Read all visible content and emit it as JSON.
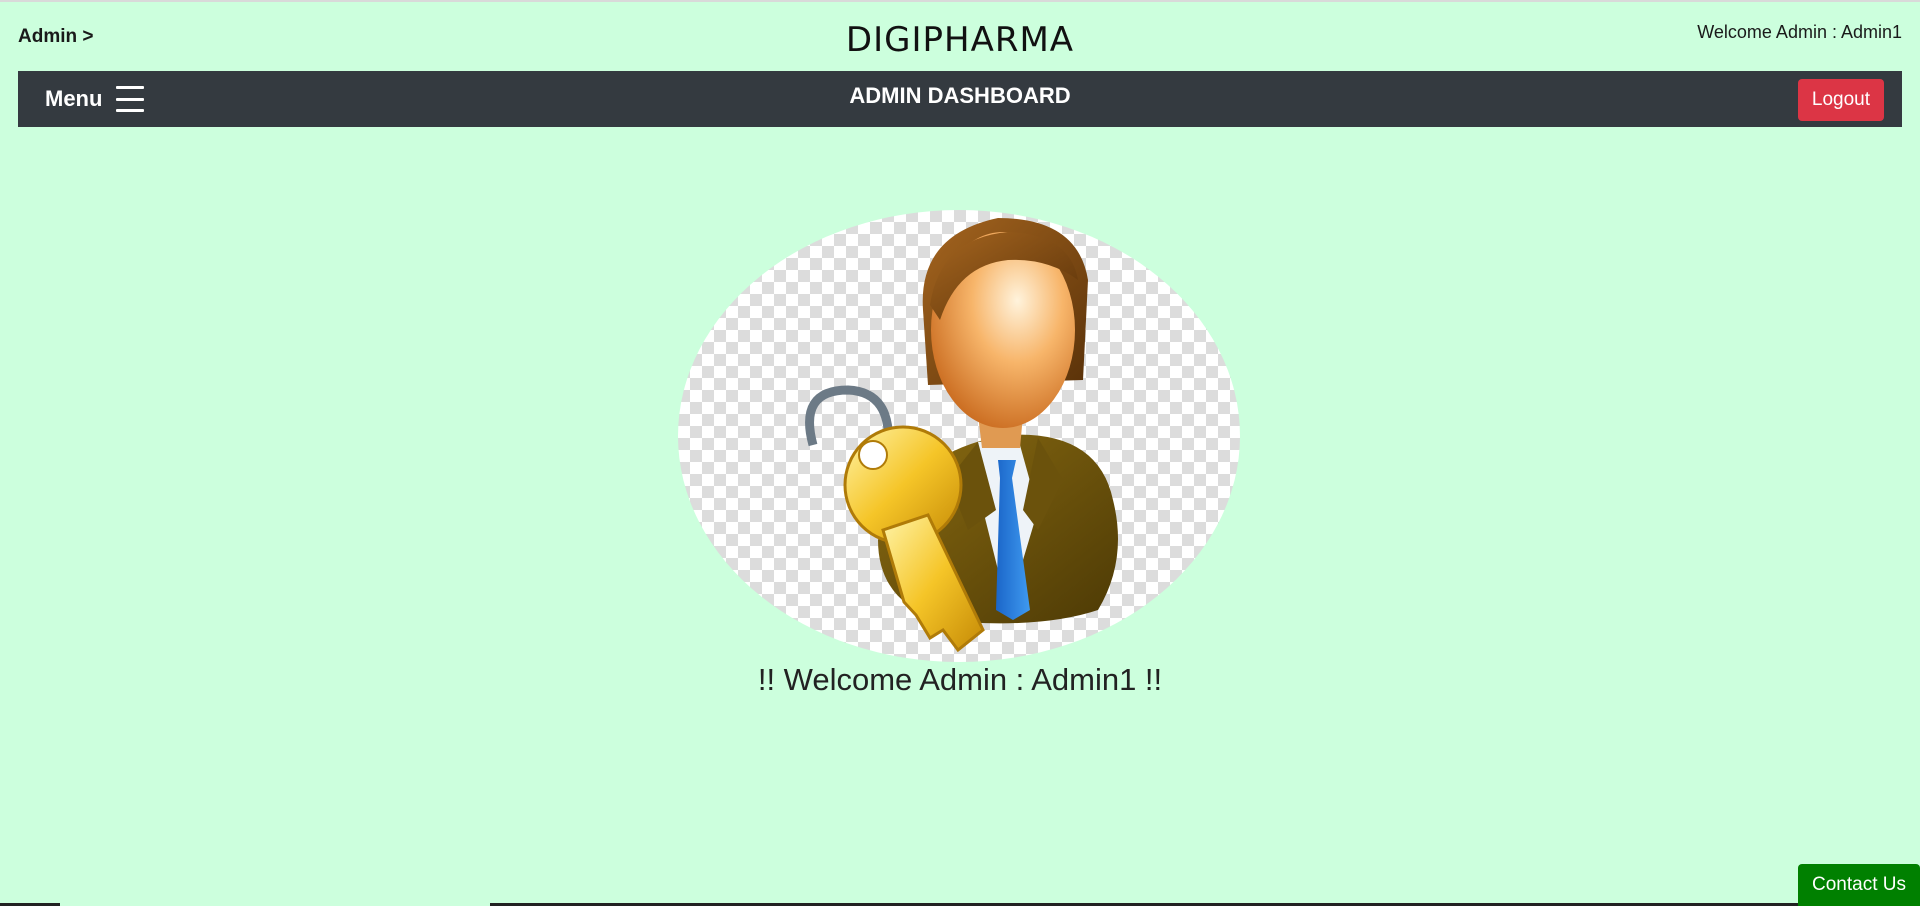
{
  "header": {
    "breadcrumb": "Admin >",
    "brand": "DIGIPHARMA",
    "welcome": "Welcome Admin : Admin1"
  },
  "navbar": {
    "menu_label": "Menu",
    "menu_icon": "hamburger-icon",
    "title": "ADMIN DASHBOARD",
    "logout_label": "Logout"
  },
  "main": {
    "avatar_icon": "admin-key-icon",
    "welcome": "!! Welcome Admin : Admin1 !!"
  },
  "footer": {
    "contact_label": "Contact Us"
  },
  "colors": {
    "background": "#ccffdd",
    "navbar": "#343a40",
    "logout": "#dc3545",
    "contact": "#008000"
  }
}
